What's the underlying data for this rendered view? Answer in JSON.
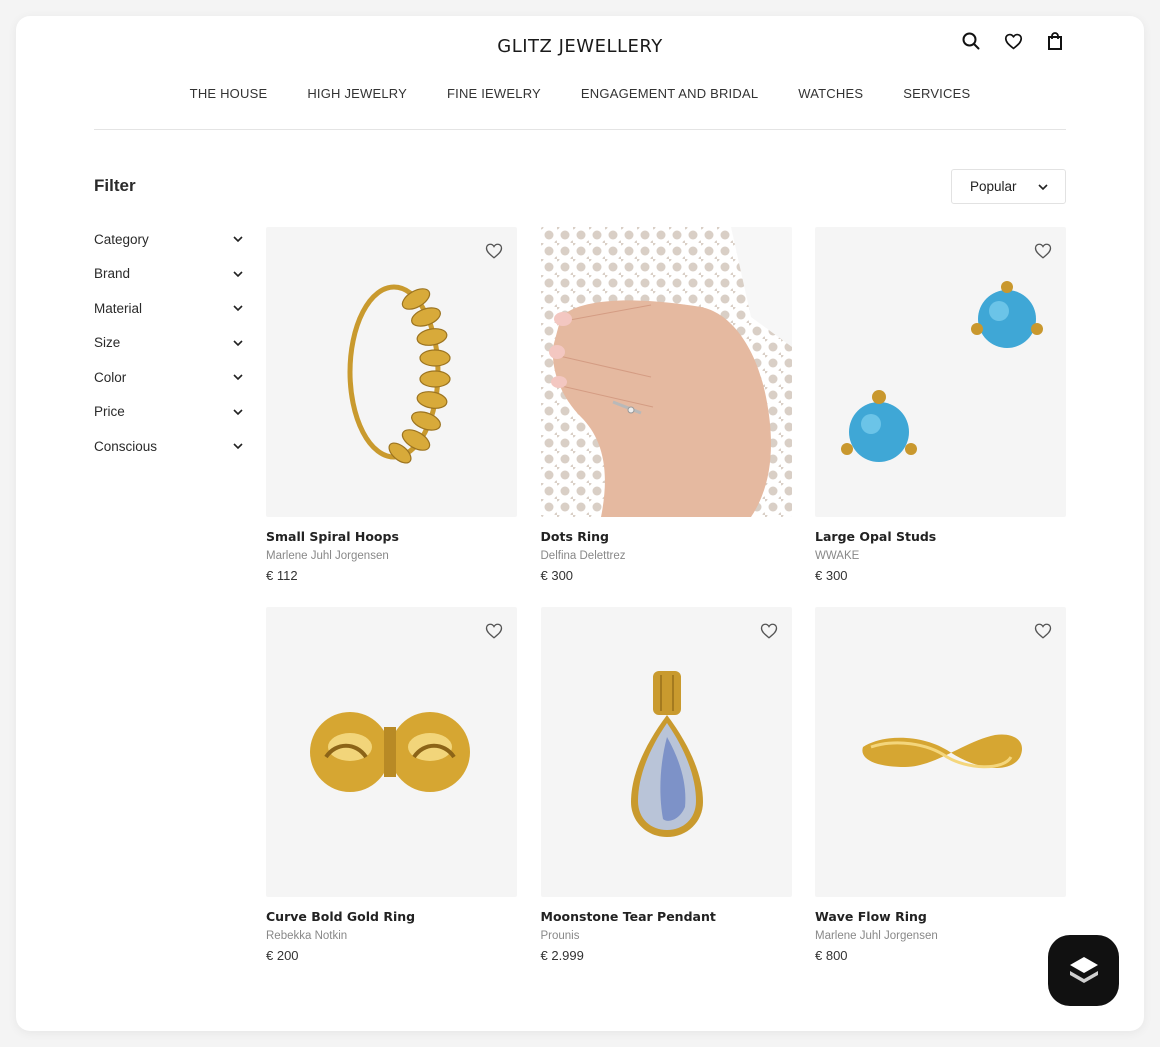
{
  "header": {
    "brand": "GLITZ JEWELLERY",
    "icons": [
      "search-icon",
      "heart-icon",
      "bag-icon"
    ]
  },
  "nav": [
    {
      "label": "THE HOUSE"
    },
    {
      "label": "HIGH JEWELRY"
    },
    {
      "label": "FINE IEWELRY"
    },
    {
      "label": "ENGAGEMENT AND BRIDAL"
    },
    {
      "label": "WATCHES"
    },
    {
      "label": "SERVICES"
    }
  ],
  "filter": {
    "title": "Filter",
    "items": [
      {
        "label": "Category"
      },
      {
        "label": "Brand"
      },
      {
        "label": "Material"
      },
      {
        "label": "Size"
      },
      {
        "label": "Color"
      },
      {
        "label": "Price"
      },
      {
        "label": "Conscious"
      }
    ]
  },
  "sort": {
    "selected": "Popular"
  },
  "products": [
    {
      "name": "Small Spiral Hoops",
      "brand": "Marlene Juhl Jorgensen",
      "price": "€ 112"
    },
    {
      "name": "Dots Ring",
      "brand": "Delfina Delettrez",
      "price": "€ 300"
    },
    {
      "name": "Large Opal Studs",
      "brand": "WWAKE",
      "price": "€ 300"
    },
    {
      "name": "Curve Bold Gold Ring",
      "brand": "Rebekka Notkin",
      "price": "€ 200"
    },
    {
      "name": "Moonstone Tear Pendant",
      "brand": "Prounis",
      "price": "€ 2.999"
    },
    {
      "name": "Wave Flow Ring",
      "brand": "Marlene Juhl Jorgensen",
      "price": "€ 800"
    }
  ],
  "colors": {
    "accent": "#111111",
    "gold": "#d4a733",
    "opal": "#3fa7d6",
    "background": "#f5f5f5"
  }
}
